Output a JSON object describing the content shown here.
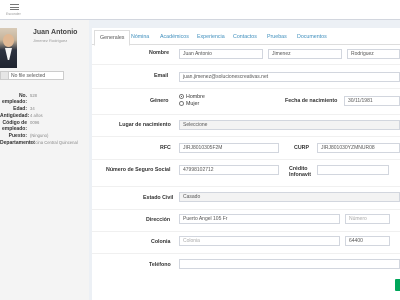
{
  "topbar": {
    "menu_label": "Esconder"
  },
  "profile": {
    "name": "Juan Antonio",
    "sub": "Jimenez Rodriguez",
    "file_status": "No file selected"
  },
  "info": [
    {
      "label": "No. empleado:",
      "value": "528"
    },
    {
      "label": "Edad:",
      "value": "34"
    },
    {
      "label": "Antigüedad:",
      "value": "4 años"
    },
    {
      "label": "Código de empleado:",
      "value": "0096"
    },
    {
      "label": "Puesto:",
      "value": "(Ninguno)"
    },
    {
      "label": "Departamento:",
      "value": "Oficina Central Quincenal"
    }
  ],
  "tabs": [
    "Generales",
    "Nómina",
    "Académicos",
    "Experiencia",
    "Contactos",
    "Pruebas",
    "Documentos"
  ],
  "form": {
    "nombre_label": "Nombre",
    "nombre": "Juan Antonio",
    "apellido_paterno": "Jimenez",
    "apellido_materno": "Rodriguez",
    "email_label": "Email",
    "email": "juan.jimenez@solucionescreativas.net",
    "genero_label": "Género",
    "genero_hombre": "Hombre",
    "genero_mujer": "Mujer",
    "fecha_label": "Fecha de nacimiento",
    "fecha": "30/11/1981",
    "lugar_label": "Lugar de nacimiento",
    "lugar": "Seleccione",
    "rfc_label": "RFC",
    "rfc": "JIRJ8010305F2M",
    "curp_label": "CURP",
    "curp": "JIRJ801030YZMNUR08",
    "nss_label": "Número de Seguro Social",
    "nss": "47998102712",
    "infonavit_label": "Crédito Infonavit",
    "estado_civil_label": "Estado Civil",
    "estado_civil": "Casado",
    "direccion_label": "Dirección",
    "direccion": "Puerto Angel 105 Fr",
    "numero_placeholder": "Número",
    "colonia_label": "Colonia",
    "colonia_placeholder": "Colonia",
    "cp": "64400",
    "telefono_label": "Teléfono"
  }
}
